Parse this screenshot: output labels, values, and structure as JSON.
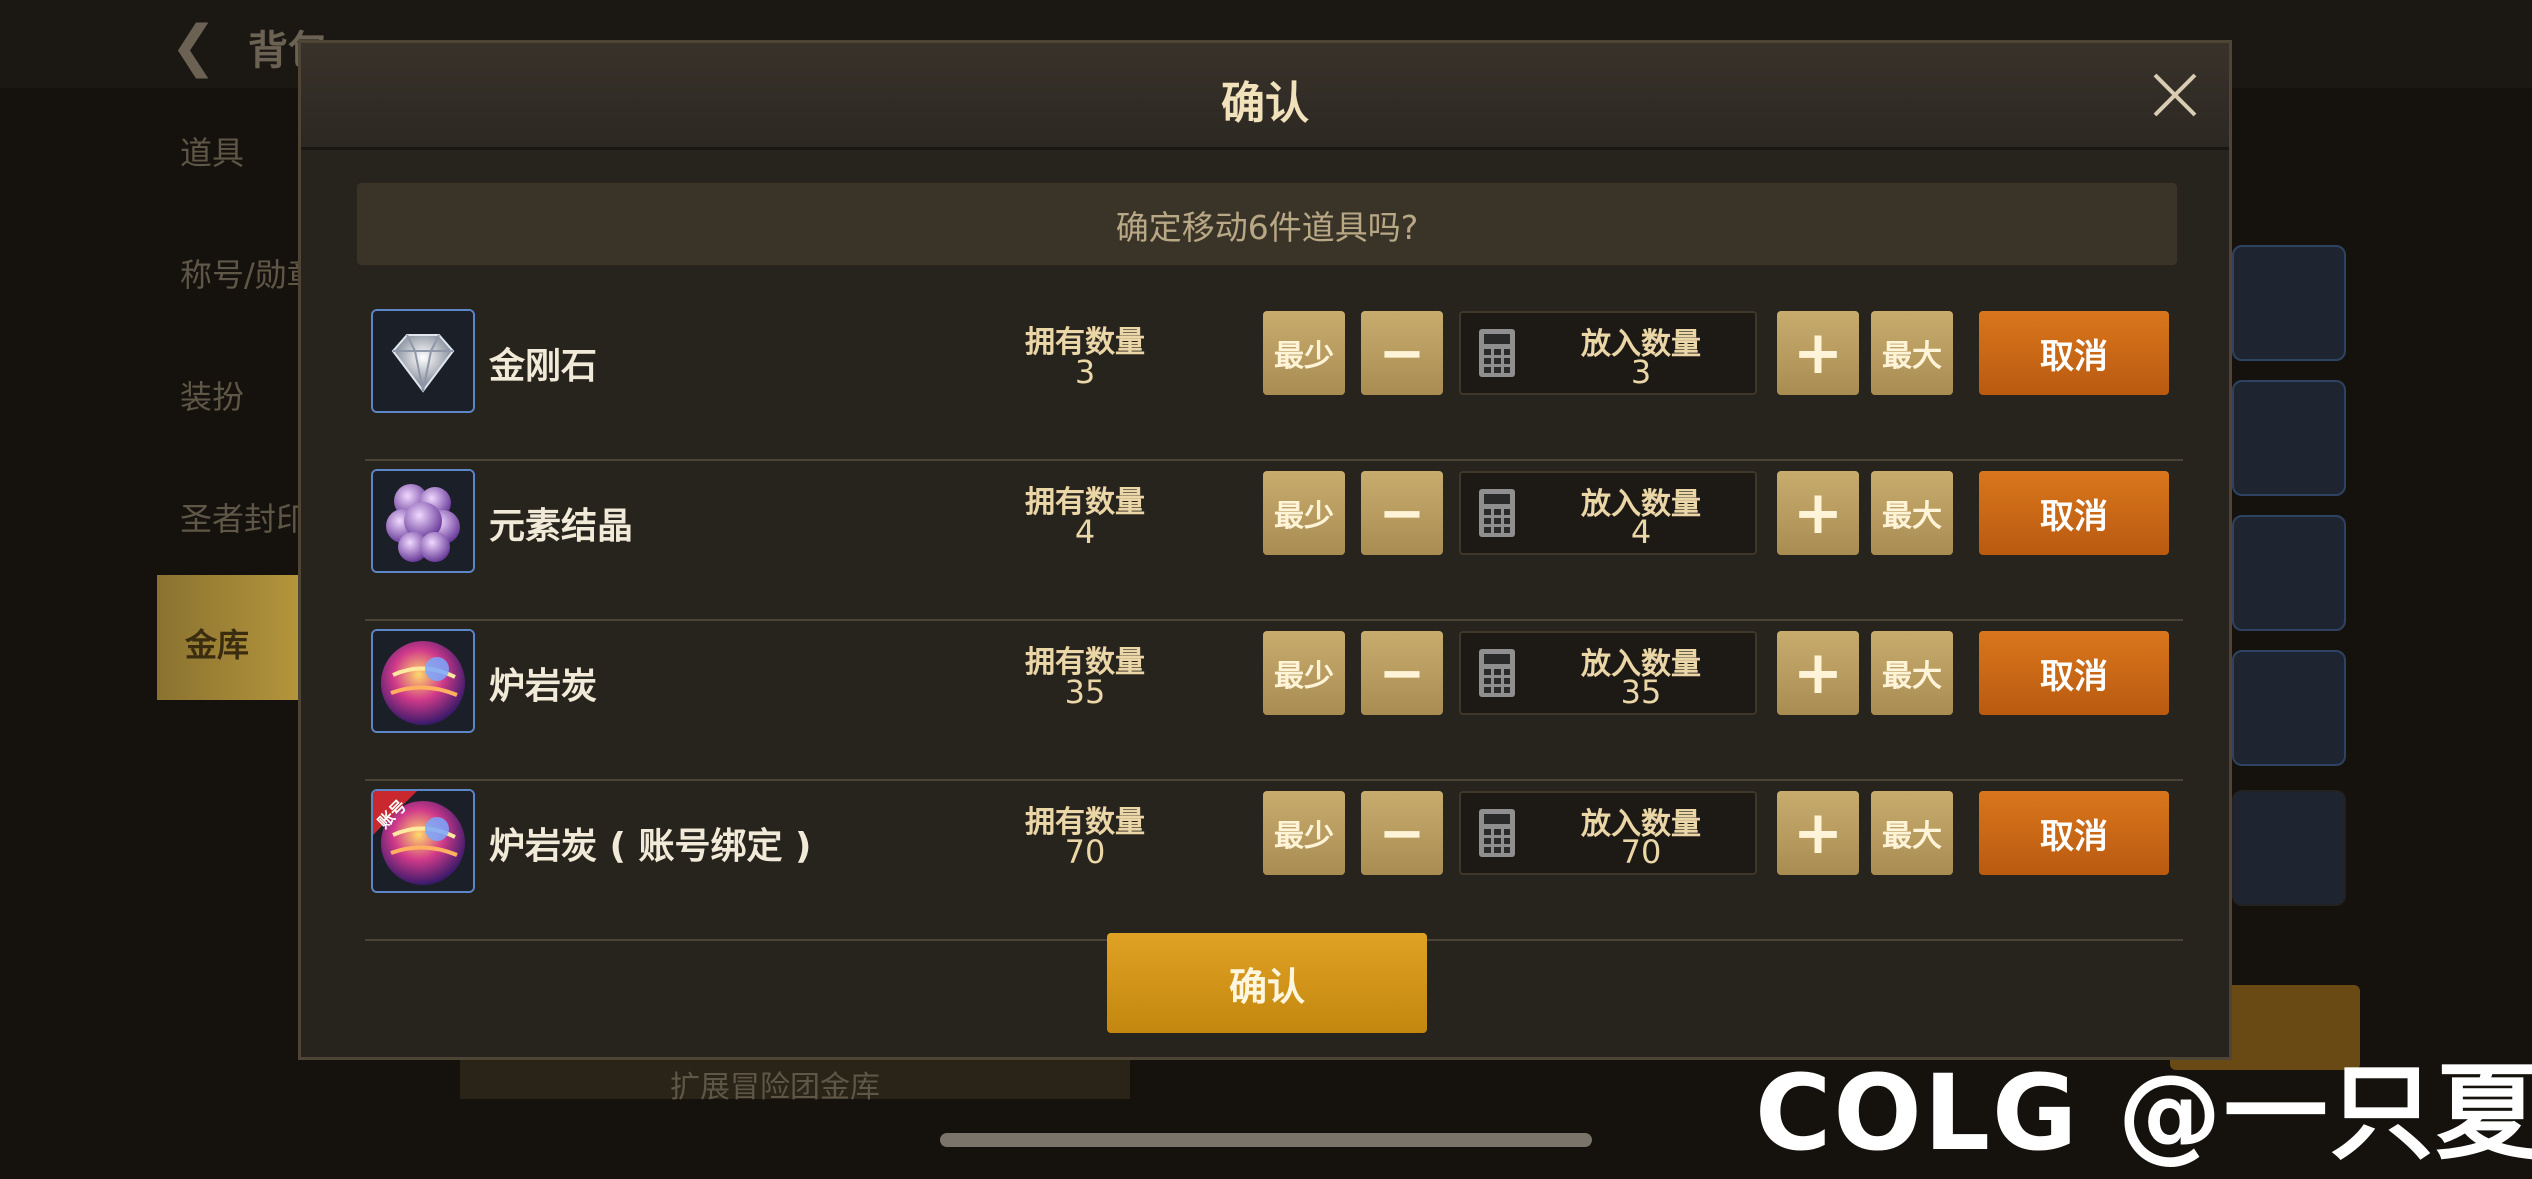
{
  "background": {
    "title": "背包",
    "sidebar": [
      "道具",
      "称号/勋章",
      "装扮",
      "圣者封印",
      "金库"
    ],
    "bottom_label": "扩展冒险团金库"
  },
  "dialog": {
    "title": "确认",
    "prompt": "确定移动6件道具吗?",
    "owned_label": "拥有数量",
    "put_label": "放入数量",
    "min_label": "最少",
    "minus_label": "−",
    "plus_label": "+",
    "max_label": "最大",
    "cancel_label": "取消",
    "confirm_label": "确认",
    "items": [
      {
        "name": "金刚石",
        "owned": "3",
        "put": "3",
        "icon": "diamond-icon"
      },
      {
        "name": "元素结晶",
        "owned": "4",
        "put": "4",
        "icon": "element-crystal-icon"
      },
      {
        "name": "炉岩炭",
        "owned": "35",
        "put": "35",
        "icon": "furnace-carbon-icon"
      },
      {
        "name": "炉岩炭 ( 账号绑定 )",
        "owned": "70",
        "put": "70",
        "icon": "furnace-carbon-bound-icon",
        "badge": "账号"
      }
    ]
  },
  "watermark": "COLG @一只夏天",
  "colors": {
    "cancel": "#c9661a",
    "confirm": "#d2941c",
    "tan_button": "#b89a5e",
    "icon_border": "#5d86c9"
  }
}
